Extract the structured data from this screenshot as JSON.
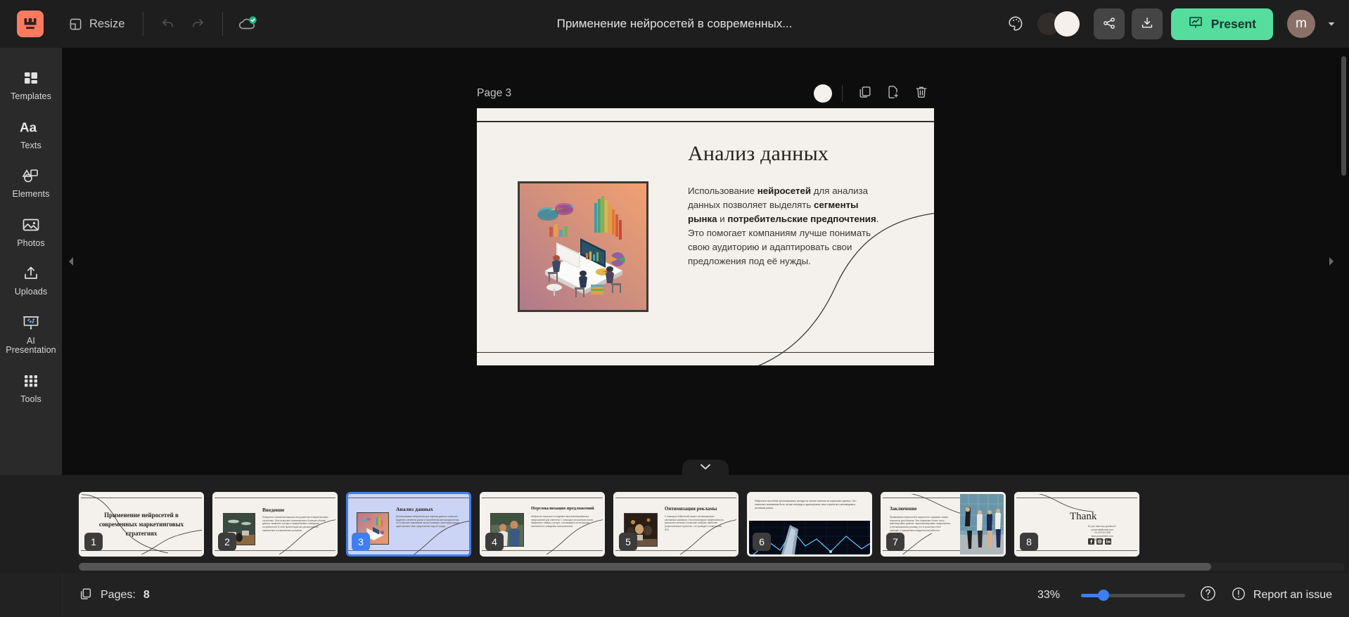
{
  "app": {
    "logo_icon": "wepik-logo-icon",
    "document_title": "Применение нейросетей в современных..."
  },
  "toolbar": {
    "resize_label": "Resize",
    "resize_icon": "resize-icon",
    "undo_icon": "undo-arrow-icon",
    "redo_icon": "redo-arrow-icon",
    "cloud_saved_icon": "cloud-saved-icon",
    "palette_icon": "palette-icon",
    "theme_toggle_icon": "theme-toggle-icon",
    "share_icon": "share-icon",
    "download_icon": "download-icon",
    "present_label": "Present",
    "present_icon": "present-screen-icon",
    "avatar_initial": "m",
    "account_caret_icon": "chevron-down-icon"
  },
  "sidebar": {
    "items": [
      {
        "label": "Templates",
        "icon": "templates-grid-icon"
      },
      {
        "label": "Texts",
        "icon": "text-aa-icon"
      },
      {
        "label": "Elements",
        "icon": "shapes-icon"
      },
      {
        "label": "Photos",
        "icon": "photo-icon"
      },
      {
        "label": "Uploads",
        "icon": "upload-icon"
      },
      {
        "label": "AI Presentation",
        "icon": "ai-presentation-icon"
      },
      {
        "label": "Tools",
        "icon": "tools-dots-icon"
      }
    ]
  },
  "canvas": {
    "page_label": "Page 3",
    "tools": {
      "background_color": "#f5f1ec",
      "color_dot_icon": "background-color-icon",
      "duplicate_icon": "duplicate-page-icon",
      "add_page_icon": "add-page-icon",
      "delete_icon": "trash-icon"
    },
    "scroll_left_icon": "scroll-left-arrow-icon",
    "scroll_right_icon": "scroll-right-arrow-icon",
    "collapse_icon": "chevron-down-icon"
  },
  "slide": {
    "title": "Анализ данных",
    "body_parts": [
      {
        "text": "Использование ",
        "bold": false
      },
      {
        "text": "нейросетей",
        "bold": true
      },
      {
        "text": " для анализа данных позволяет выделять ",
        "bold": false
      },
      {
        "text": "сегменты рынка",
        "bold": true
      },
      {
        "text": " и ",
        "bold": false
      },
      {
        "text": "потребительские предпочтения",
        "bold": true
      },
      {
        "text": ". Это помогает компаниям лучше понимать свою аудиторию и адаптировать свои предложения под её нужды.",
        "bold": false
      }
    ],
    "image_alt": "isometric-data-analysis-illustration",
    "background": "#f4f1ec",
    "title_color": "#25211f"
  },
  "filmstrip": {
    "slides": [
      {
        "number": "1",
        "layout": "title",
        "title": "Применение нейросетей в современных маркетинговых стратегиях",
        "text": "",
        "image": "none"
      },
      {
        "number": "2",
        "layout": "image-left",
        "title": "Введение",
        "text": "Нейросети становятся важным инструментом в маркетинговых стратегиях. Они позволяют анализировать большие объемы данных, выявлять тренды и предсказывать поведение потребителей. В этой презентации мы рассмотрим их применение в современных условиях.",
        "image": "office-interior-photo"
      },
      {
        "number": "3",
        "layout": "image-left",
        "title": "Анализ данных",
        "text": "Использование нейросетей для анализа данных позволяет выделять сегменты рынка и потребительские предпочтения. Это помогает компаниям лучше понимать свою аудиторию и адаптировать свои предложения под её нужды.",
        "image": "isometric-data-analysis-illustration",
        "active": true
      },
      {
        "number": "4",
        "layout": "image-left",
        "title": "Персонализация предложений",
        "text": "Нейросети помогают в создании персонализированных предложений для клиентов. С помощью алгоритмов можно предлагать товары и услуги, основываясь на интересах посетителя и поведении пользователей.",
        "image": "couple-with-phone-photo"
      },
      {
        "number": "5",
        "layout": "image-left",
        "title": "Оптимизация рекламы",
        "text": "С помощью нейросетей можно оптимизировать рекламные кампании. Они анализируют эффективность различных каналов и помогают выбрать наиболее результативные стратегии, что приводит к повышению ROI.",
        "image": "business-meeting-photo"
      },
      {
        "number": "6",
        "layout": "text-top-image-bottom",
        "title": "",
        "text": "Нейросети способны прогнозировать тренды на основе анализа исторических данных. Это позволяет компаниям быть на шаг впереди и адаптировать свои стратегии к меняющимся условиям рынка.",
        "image": "dark-blue-analytics-chart-photo"
      },
      {
        "number": "7",
        "layout": "image-right",
        "title": "Заключение",
        "text": "Применение нейросетей в маркетинге открывает новые горизонты для бизнеса. Они позволяют более точно анализировать данные, персонализировать предложения и оптимизировать рекламу, что в конечном итоге приводит к повышению конкурентоспособности.",
        "image": "celebrating-people-photo"
      },
      {
        "number": "8",
        "layout": "thanks",
        "title": "Thank",
        "text": "Do you have any questions?\nyouremail@email.com\n+91 620 421 838\nwww.yourwebsite.com\n@yourusername",
        "image": "none"
      }
    ]
  },
  "status": {
    "pages_label": "Pages:",
    "pages_count": "8",
    "pages_icon": "pages-stack-icon",
    "zoom_level": "33%",
    "help_icon": "help-question-icon",
    "report_icon": "report-exclamation-icon",
    "report_label": "Report an issue"
  },
  "colors": {
    "accent_green": "#55dd9d",
    "accent_blue": "#3d7ff0",
    "logo_coral": "#ff7a5e",
    "topbar_bg": "#1e1e1e",
    "canvas_bg": "#0d0d0d",
    "rail_bg": "#2a2a2a"
  }
}
